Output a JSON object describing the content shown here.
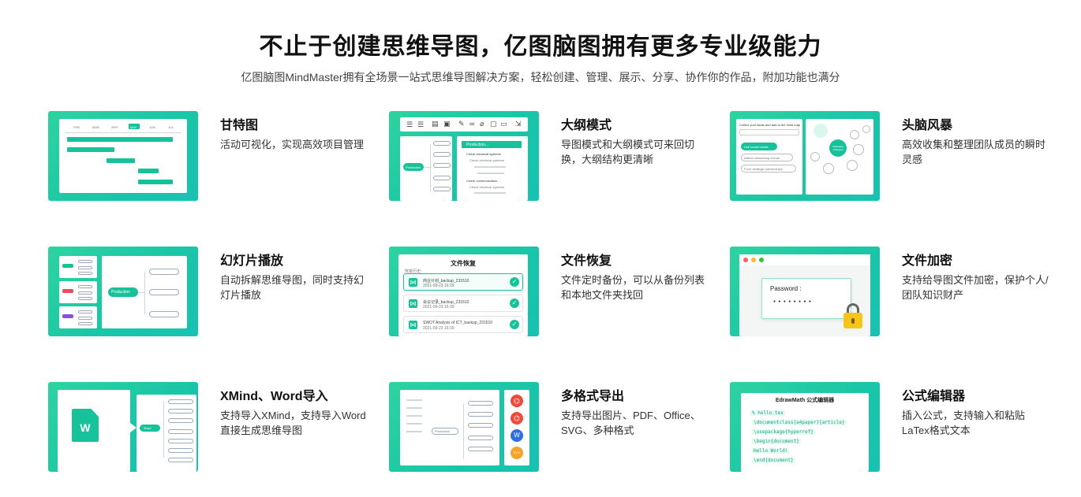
{
  "header": {
    "title": "不止于创建思维导图，亿图脑图拥有更多专业级能力",
    "subtitle": "亿图脑图MindMaster拥有全场景一站式思维导图解决方案，轻松创建、管理、展示、分享、协作你的作品，附加功能也满分"
  },
  "features": [
    {
      "title": "甘特图",
      "desc": "活动可视化，实现高效项目管理"
    },
    {
      "title": "大纲模式",
      "desc": "导图模式和大纲模式可来回切换，大纲结构更清晰"
    },
    {
      "title": "头脑风暴",
      "desc": "高效收集和整理团队成员的瞬时灵感"
    },
    {
      "title": "幻灯片播放",
      "desc": "自动拆解思维导图，同时支持幻灯片播放"
    },
    {
      "title": "文件恢复",
      "desc": "文件定时备份，可以从备份列表和本地文件夹找回"
    },
    {
      "title": "文件加密",
      "desc": "支持给导图文件加密，保护个人/团队知识财产"
    },
    {
      "title": "XMind、Word导入",
      "desc": "支持导入XMind，支持导入Word直接生成思维导图"
    },
    {
      "title": "多格式导出",
      "desc": "支持导出图片、PDF、Office、SVG、多种格式"
    },
    {
      "title": "公式编辑器",
      "desc": "插入公式，支持输入和粘贴LaTex格式文本"
    }
  ],
  "thumbs": {
    "gantt_months": [
      "FEB",
      "MAR",
      "APR",
      "MAY",
      "JUN",
      "JUL"
    ],
    "outline_root": "Production",
    "outline_items": [
      "Production...",
      "Check electrical systems",
      "Check electrical systems",
      "Check communication...",
      "Check electrical systems"
    ],
    "brainstorm_prompt": "Collect your ideas and add to the mind map",
    "brainstorm_ideas": [
      "Use social media",
      "Attend networking events",
      "Form strategic partnerships"
    ],
    "brainstorm_center": "Marketing strategies",
    "slide_root": "Production",
    "recovery_title": "文件恢复",
    "recovery_label": "恢复历史:",
    "recovery_files": [
      {
        "name": "商业计划_backup_231510",
        "time": "2021-09-23 16:39"
      },
      {
        "name": "会议记录_backup_231510",
        "time": "2021-09-23 16:39"
      },
      {
        "name": "SWOT Analysis of ICT_backup_231510",
        "time": "2021-09-23 16:39"
      }
    ],
    "password_label": "Password :",
    "password_mask": "● ● ● ● ● ● ● ●",
    "word_icon": "W",
    "word_node": "Word",
    "export_root": "Production",
    "export_formats": [
      "PDF",
      "PDF",
      "Word",
      "SVG"
    ],
    "export_svg_label": "SVG",
    "math_title": "EdrawMath 公式编辑器",
    "math_lines": [
      "% hello.tex",
      "\\documentclass[a4paper]{article}",
      "\\usepackage{hyperref}",
      "\\begin{document}",
      "Hello World!",
      "\\end{document}"
    ]
  },
  "colors": {
    "brand": "#17c29a",
    "gradient_start": "#2ed3a0",
    "gradient_end": "#17c2b2",
    "close": "#ff5f57",
    "minimize": "#febc2e",
    "maximize": "#28c840",
    "pdf": "#f04a3a",
    "word": "#2f6fe0",
    "svg": "#f5a32a"
  }
}
